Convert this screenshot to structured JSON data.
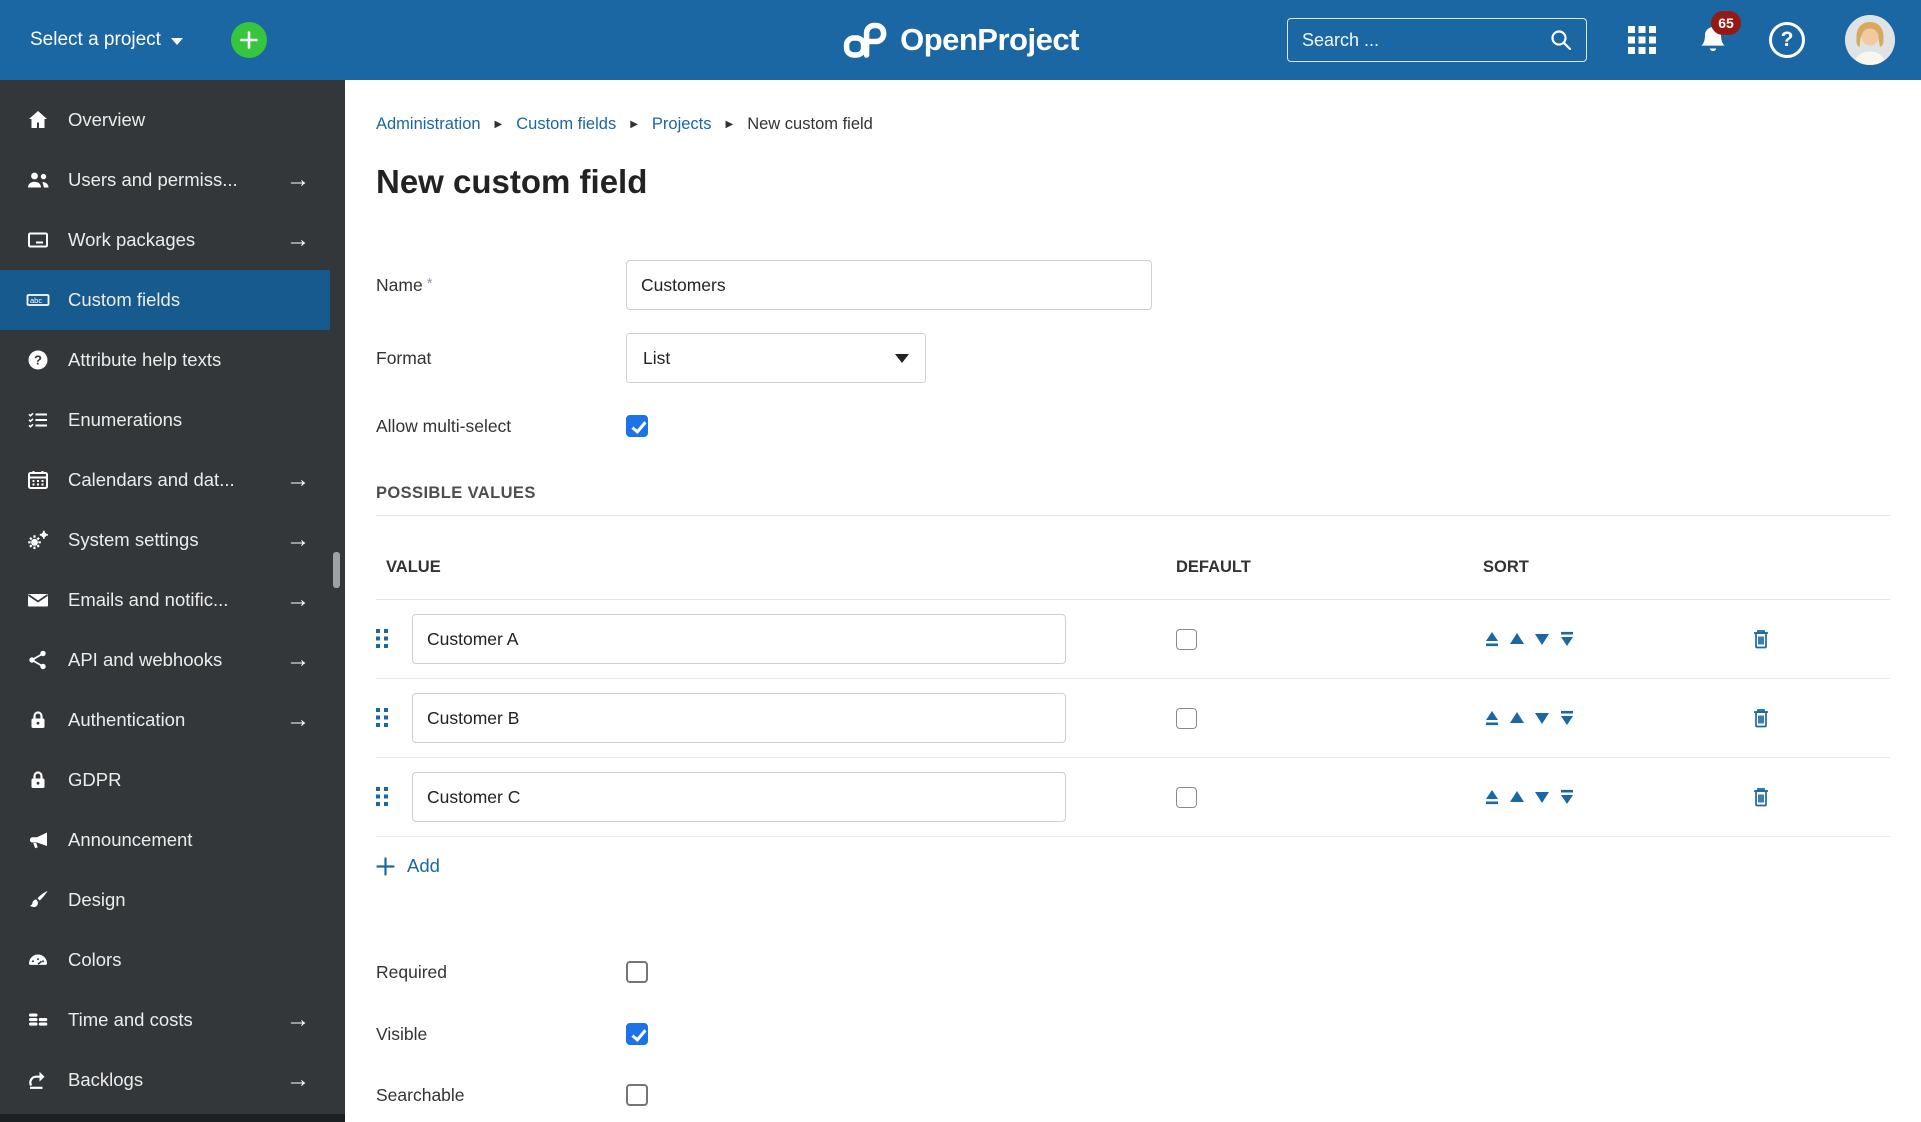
{
  "colors": {
    "topbar_bg": "#1A67A3",
    "sidebar_bg": "#333739",
    "selected_item_bg": "#175A8E",
    "accent_blue": "#1A67A3",
    "checkbox_checked": "#1A73E8",
    "notification_badge": "#941A16",
    "add_project_green": "#35C53F"
  },
  "topbar": {
    "project_selector_label": "Select a project",
    "logo_text": "OpenProject",
    "search_placeholder": "Search ...",
    "notification_count": "65"
  },
  "sidebar": {
    "items": [
      {
        "label": "Overview",
        "selected": false,
        "has_arrow": false
      },
      {
        "label": "Users and permiss...",
        "selected": false,
        "has_arrow": true
      },
      {
        "label": "Work packages",
        "selected": false,
        "has_arrow": true
      },
      {
        "label": "Custom fields",
        "selected": true,
        "has_arrow": false
      },
      {
        "label": "Attribute help texts",
        "selected": false,
        "has_arrow": false
      },
      {
        "label": "Enumerations",
        "selected": false,
        "has_arrow": false
      },
      {
        "label": "Calendars and dat...",
        "selected": false,
        "has_arrow": true
      },
      {
        "label": "System settings",
        "selected": false,
        "has_arrow": true
      },
      {
        "label": "Emails and notific...",
        "selected": false,
        "has_arrow": true
      },
      {
        "label": "API and webhooks",
        "selected": false,
        "has_arrow": true
      },
      {
        "label": "Authentication",
        "selected": false,
        "has_arrow": true
      },
      {
        "label": "GDPR",
        "selected": false,
        "has_arrow": false
      },
      {
        "label": "Announcement",
        "selected": false,
        "has_arrow": false
      },
      {
        "label": "Design",
        "selected": false,
        "has_arrow": false
      },
      {
        "label": "Colors",
        "selected": false,
        "has_arrow": false
      },
      {
        "label": "Time and costs",
        "selected": false,
        "has_arrow": true
      },
      {
        "label": "Backlogs",
        "selected": false,
        "has_arrow": true
      }
    ]
  },
  "breadcrumb": {
    "links": [
      "Administration",
      "Custom fields",
      "Projects"
    ],
    "current": "New custom field"
  },
  "page_title": "New custom field",
  "form": {
    "name": {
      "label": "Name",
      "required_marker": "*",
      "value": "Customers"
    },
    "format": {
      "label": "Format",
      "value": "List"
    },
    "multi_select": {
      "label": "Allow multi-select",
      "checked": true
    },
    "possible_values": {
      "heading": "POSSIBLE VALUES",
      "columns": {
        "value": "VALUE",
        "default": "DEFAULT",
        "sort": "SORT"
      },
      "rows": [
        {
          "value": "Customer A",
          "default_checked": false
        },
        {
          "value": "Customer B",
          "default_checked": false
        },
        {
          "value": "Customer C",
          "default_checked": false
        }
      ],
      "add_label": "Add"
    },
    "required": {
      "label": "Required",
      "checked": false
    },
    "visible": {
      "label": "Visible",
      "checked": true
    },
    "searchable": {
      "label": "Searchable",
      "checked": false
    }
  }
}
